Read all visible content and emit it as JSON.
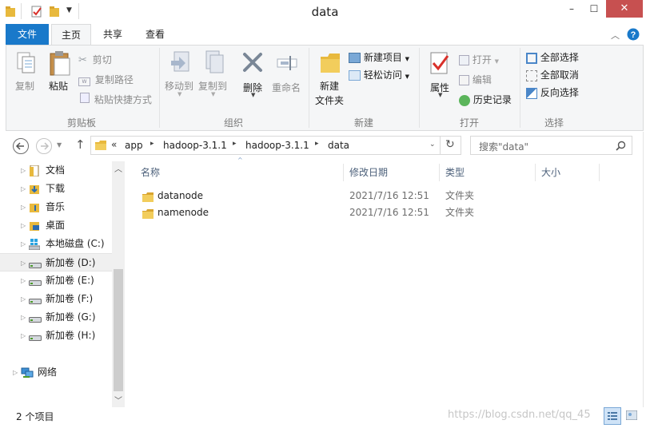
{
  "window": {
    "title": "data",
    "minimize_glyph": "–",
    "maximize_glyph": "☐",
    "close_glyph": "✕"
  },
  "ribbon": {
    "tabs": [
      {
        "label": "文件"
      },
      {
        "label": "主页"
      },
      {
        "label": "共享"
      },
      {
        "label": "查看"
      }
    ],
    "groups": {
      "clipboard": {
        "label": "剪贴板",
        "copy": "复制",
        "paste": "粘贴",
        "cut": "剪切",
        "copy_path": "复制路径",
        "paste_shortcut": "粘贴快捷方式"
      },
      "organize": {
        "label": "组织",
        "move_to": "移动到",
        "copy_to": "复制到",
        "delete": "删除",
        "rename": "重命名"
      },
      "new": {
        "label": "新建",
        "new_folder_line1": "新建",
        "new_folder_line2": "文件夹",
        "new_item": "新建项目",
        "easy_access": "轻松访问"
      },
      "open": {
        "label": "打开",
        "properties": "属性",
        "open": "打开",
        "edit": "编辑",
        "history": "历史记录"
      },
      "select": {
        "label": "选择",
        "select_all": "全部选择",
        "select_none": "全部取消",
        "invert": "反向选择"
      }
    }
  },
  "address": {
    "prefix": "«",
    "crumbs": [
      "app",
      "hadoop-3.1.1",
      "hadoop-3.1.1",
      "data"
    ],
    "search_placeholder": "搜索\"data\""
  },
  "nav": {
    "items": [
      {
        "label": "文档",
        "icon": "documents-icon"
      },
      {
        "label": "下载",
        "icon": "downloads-icon"
      },
      {
        "label": "音乐",
        "icon": "music-icon"
      },
      {
        "label": "桌面",
        "icon": "desktop-icon"
      },
      {
        "label": "本地磁盘 (C:)",
        "icon": "windows-drive-icon"
      },
      {
        "label": "新加卷 (D:)",
        "icon": "drive-icon"
      },
      {
        "label": "新加卷 (E:)",
        "icon": "drive-icon"
      },
      {
        "label": "新加卷 (F:)",
        "icon": "drive-icon"
      },
      {
        "label": "新加卷 (G:)",
        "icon": "drive-icon"
      },
      {
        "label": "新加卷 (H:)",
        "icon": "drive-icon"
      },
      {
        "label": "网络",
        "icon": "network-icon"
      }
    ]
  },
  "files": {
    "columns": [
      "名称",
      "修改日期",
      "类型",
      "大小"
    ],
    "rows": [
      {
        "name": "datanode",
        "date": "2021/7/16 12:51",
        "type": "文件夹"
      },
      {
        "name": "namenode",
        "date": "2021/7/16 12:51",
        "type": "文件夹"
      }
    ]
  },
  "status": {
    "count": "2 个项目",
    "watermark": "https://blog.csdn.net/qq_45"
  },
  "colors": {
    "file_tab": "#1979ca",
    "ribbon_bg": "#f5f6f7",
    "folder": "#e8b93d",
    "header_text": "#4c607a"
  }
}
